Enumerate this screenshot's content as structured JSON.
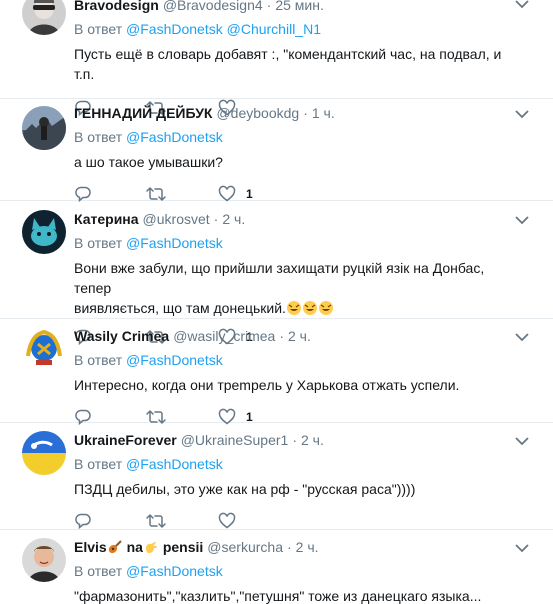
{
  "reply_prefix": "В ответ",
  "tweets": [
    {
      "name": "Bravodesign",
      "handle": "@Bravodesign4",
      "time": "25 мин.",
      "reply_to": [
        "@FashDonetsk",
        "@Churchill_N1"
      ],
      "text": "Пусть ещё в словарь добавят :, \"комендантский час, на подвал, и т.п.",
      "likes": ""
    },
    {
      "name": "ГЕННАДИЙ ДЕЙБУК",
      "handle": "@deybookdg",
      "time": "1 ч.",
      "reply_to": [
        "@FashDonetsk"
      ],
      "text": "а шо такое умывашки?",
      "likes": "1"
    },
    {
      "name": "Катерина",
      "handle": "@ukrosvet",
      "time": "2 ч.",
      "reply_to": [
        "@FashDonetsk"
      ],
      "text_line1": "Вони вже забули, що прийшли захищати руцкій язік на Донбас, тепер",
      "text_line2": "виявляється, що там донецький.",
      "text_emoji_name": "rofl-emoji",
      "likes": "1"
    },
    {
      "name": "Wasily Crimea",
      "handle": "@wasily_crimea",
      "time": "2 ч.",
      "reply_to": [
        "@FashDonetsk"
      ],
      "text": "Интересно, когда они трempeль у Харькова отжать успели.",
      "likes": "1"
    },
    {
      "name": "UkraineForever",
      "handle": "@UkraineSuper1",
      "time": "2 ч.",
      "reply_to": [
        "@FashDonetsk"
      ],
      "text": "ПЗДЦ дебилы, это уже как на рф - \"русская раса\"))))",
      "likes": ""
    },
    {
      "name_part1": "Elvis",
      "name_part2": "na",
      "name_part3": "pensii",
      "handle": "@serkurcha",
      "time": "2 ч.",
      "reply_to": [
        "@FashDonetsk"
      ],
      "text": "\"фармазонить\",\"казлить\",\"петушня\" тоже из данецкаго языка..."
    }
  ],
  "colors": {
    "link": "#1da1f2",
    "muted": "#657786",
    "text": "#14171a",
    "border": "#e6ecf0"
  }
}
